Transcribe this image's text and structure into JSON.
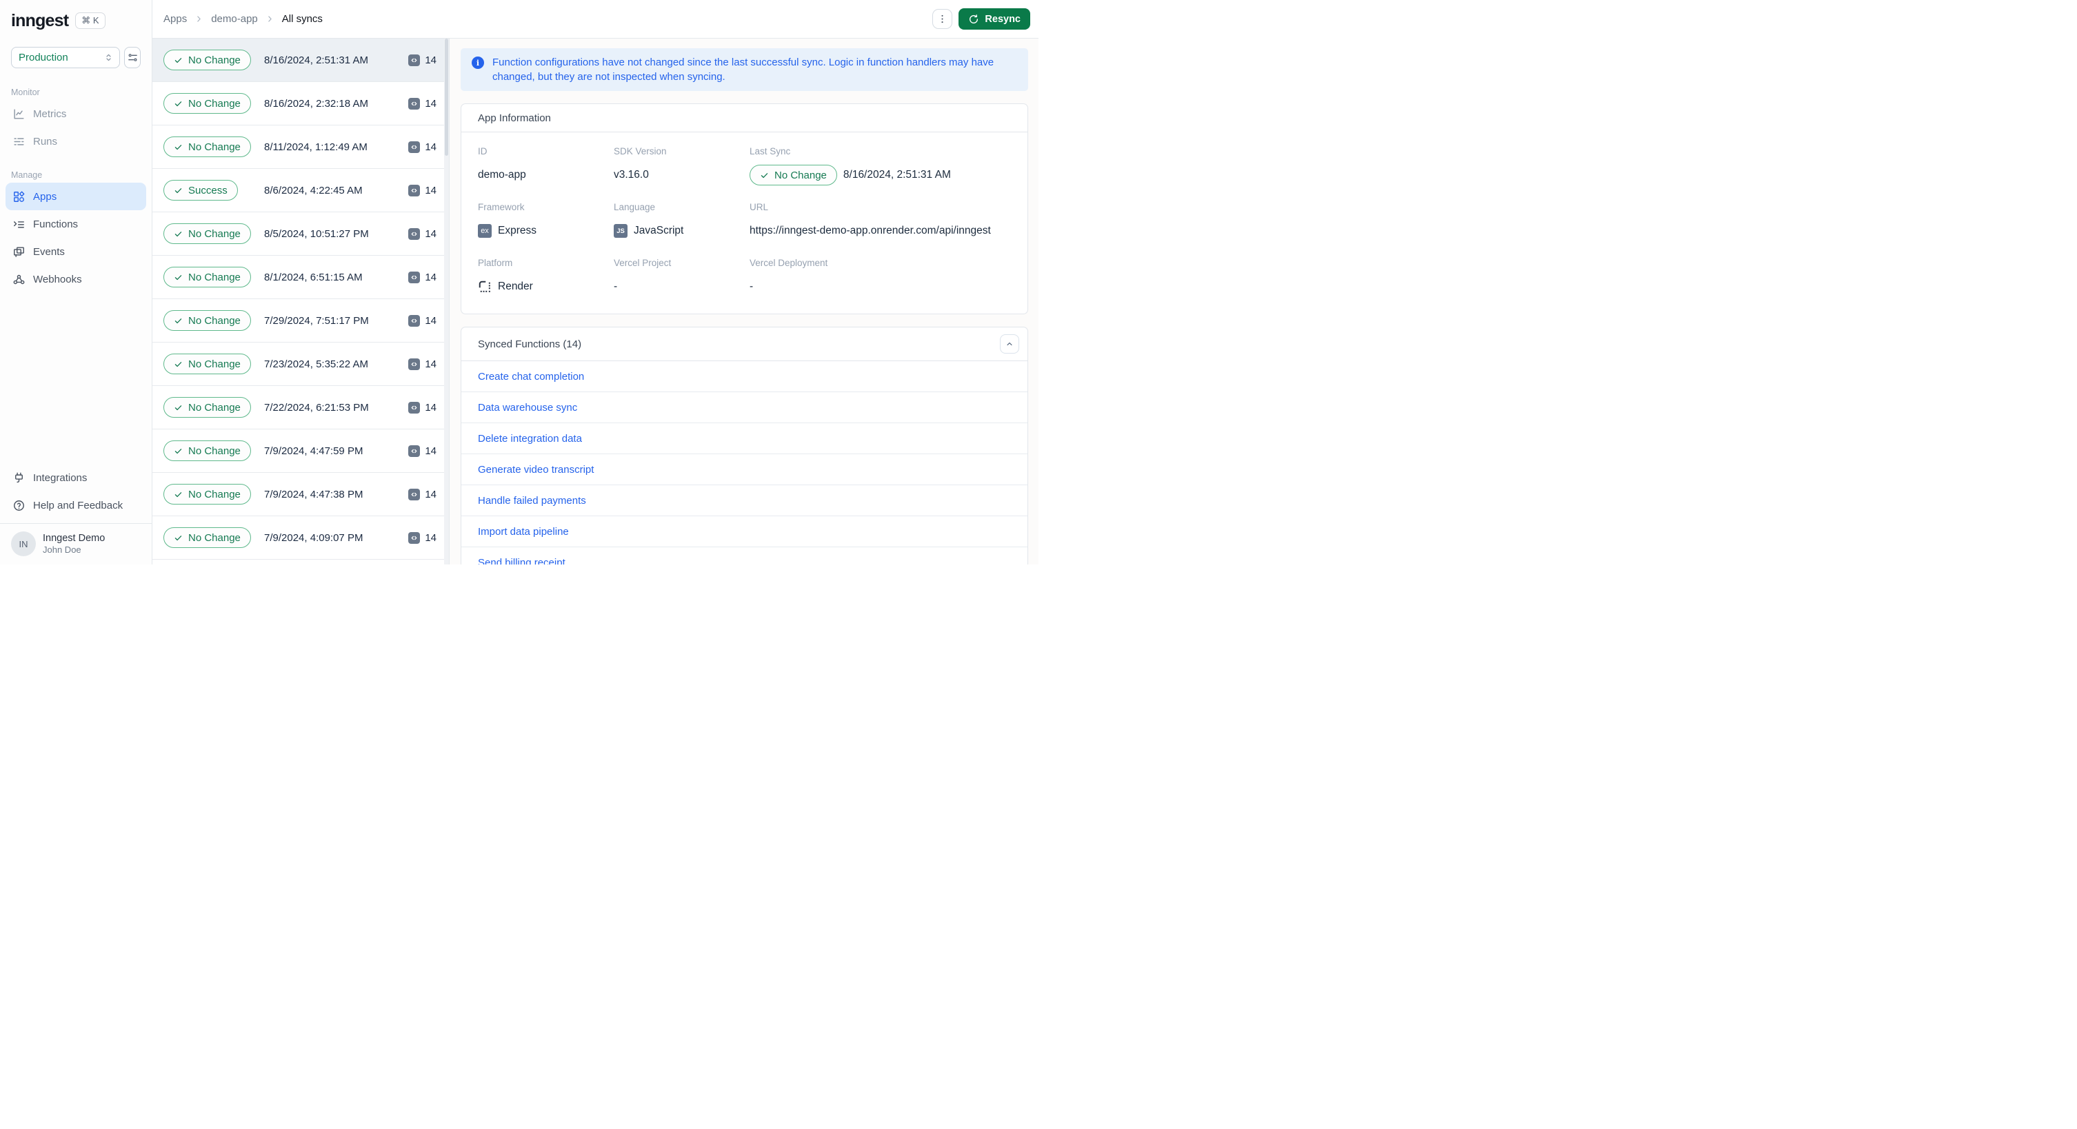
{
  "brand": {
    "logo": "inngest",
    "shortcut_keys": "⌘ K"
  },
  "sidebar": {
    "environment": "Production",
    "monitor_label": "Monitor",
    "manage_label": "Manage",
    "monitor_items": [
      {
        "label": "Metrics"
      },
      {
        "label": "Runs"
      }
    ],
    "manage_items": [
      {
        "label": "Apps",
        "active": true
      },
      {
        "label": "Functions"
      },
      {
        "label": "Events"
      },
      {
        "label": "Webhooks"
      }
    ],
    "footer_items": [
      {
        "label": "Integrations"
      },
      {
        "label": "Help and Feedback"
      }
    ],
    "user": {
      "initials": "IN",
      "organization": "Inngest Demo",
      "name": "John Doe"
    }
  },
  "header": {
    "breadcrumb": [
      "Apps",
      "demo-app",
      "All syncs"
    ],
    "resync_button": "Resync"
  },
  "banner": {
    "text": "Function configurations have not changed since the last successful sync. Logic in function handlers may have changed, but they are not inspected when syncing."
  },
  "sync_list": [
    {
      "status": "No Change",
      "timestamp": "8/16/2024, 2:51:31 AM",
      "count": "14",
      "selected": true
    },
    {
      "status": "No Change",
      "timestamp": "8/16/2024, 2:32:18 AM",
      "count": "14"
    },
    {
      "status": "No Change",
      "timestamp": "8/11/2024, 1:12:49 AM",
      "count": "14"
    },
    {
      "status": "Success",
      "timestamp": "8/6/2024, 4:22:45 AM",
      "count": "14"
    },
    {
      "status": "No Change",
      "timestamp": "8/5/2024, 10:51:27 PM",
      "count": "14"
    },
    {
      "status": "No Change",
      "timestamp": "8/1/2024, 6:51:15 AM",
      "count": "14"
    },
    {
      "status": "No Change",
      "timestamp": "7/29/2024, 7:51:17 PM",
      "count": "14"
    },
    {
      "status": "No Change",
      "timestamp": "7/23/2024, 5:35:22 AM",
      "count": "14"
    },
    {
      "status": "No Change",
      "timestamp": "7/22/2024, 6:21:53 PM",
      "count": "14"
    },
    {
      "status": "No Change",
      "timestamp": "7/9/2024, 4:47:59 PM",
      "count": "14"
    },
    {
      "status": "No Change",
      "timestamp": "7/9/2024, 4:47:38 PM",
      "count": "14"
    },
    {
      "status": "No Change",
      "timestamp": "7/9/2024, 4:09:07 PM",
      "count": "14"
    }
  ],
  "app_info": {
    "title": "App Information",
    "fields": [
      {
        "label": "ID",
        "value": "demo-app",
        "type": "text"
      },
      {
        "label": "SDK Version",
        "value": "v3.16.0",
        "type": "text"
      },
      {
        "label": "Last Sync",
        "badge": "No Change",
        "value": "8/16/2024, 2:51:31 AM",
        "type": "badge-text"
      },
      {
        "label": "Framework",
        "value": "Express",
        "icon": "ex",
        "type": "icon-text"
      },
      {
        "label": "Language",
        "value": "JavaScript",
        "icon": "JS",
        "type": "icon-text"
      },
      {
        "label": "URL",
        "value": "https://inngest-demo-app.onrender.com/api/inngest",
        "type": "text"
      },
      {
        "label": "Platform",
        "value": "Render",
        "icon": "render",
        "type": "icon-text"
      },
      {
        "label": "Vercel Project",
        "value": "-",
        "type": "text"
      },
      {
        "label": "Vercel Deployment",
        "value": "-",
        "type": "text"
      }
    ]
  },
  "synced_functions": {
    "title": "Synced Functions (14)",
    "items": [
      "Create chat completion",
      "Data warehouse sync",
      "Delete integration data",
      "Generate video transcript",
      "Handle failed payments",
      "Import data pipeline",
      "Send billing receipt"
    ]
  },
  "colors": {
    "accent_green": "#0a7a49",
    "badge_green": "#157a52",
    "link_blue": "#2563eb",
    "active_nav_blue": "#2563eb",
    "selected_row": "#ecf0f4"
  }
}
